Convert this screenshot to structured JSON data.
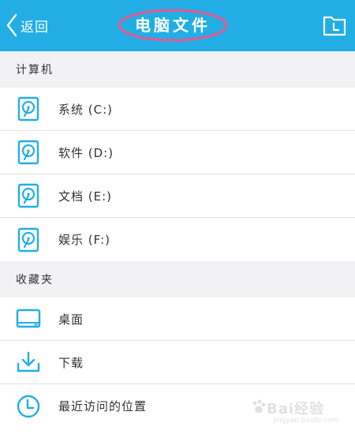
{
  "header": {
    "back_label": "返回",
    "title": "电脑文件",
    "title_highlight_color": "#e8578f",
    "background_color": "#22aee4",
    "back_icon": "chevron-left-icon",
    "folder_icon": "folder-icon"
  },
  "sections": [
    {
      "title": "计算机",
      "items": [
        {
          "label": "系统 (C:)",
          "icon": "hard-drive-icon"
        },
        {
          "label": "软件 (D:)",
          "icon": "hard-drive-icon"
        },
        {
          "label": "文档 (E:)",
          "icon": "hard-drive-icon"
        },
        {
          "label": "娱乐 (F:)",
          "icon": "hard-drive-icon"
        }
      ]
    },
    {
      "title": "收藏夹",
      "items": [
        {
          "label": "桌面",
          "icon": "desktop-icon"
        },
        {
          "label": "下载",
          "icon": "download-icon"
        },
        {
          "label": "最近访问的位置",
          "icon": "clock-icon"
        }
      ]
    }
  ],
  "watermark": {
    "brand": "Bai经验",
    "url": "jingyan.baidu.com"
  },
  "icon_color": "#22aee4"
}
